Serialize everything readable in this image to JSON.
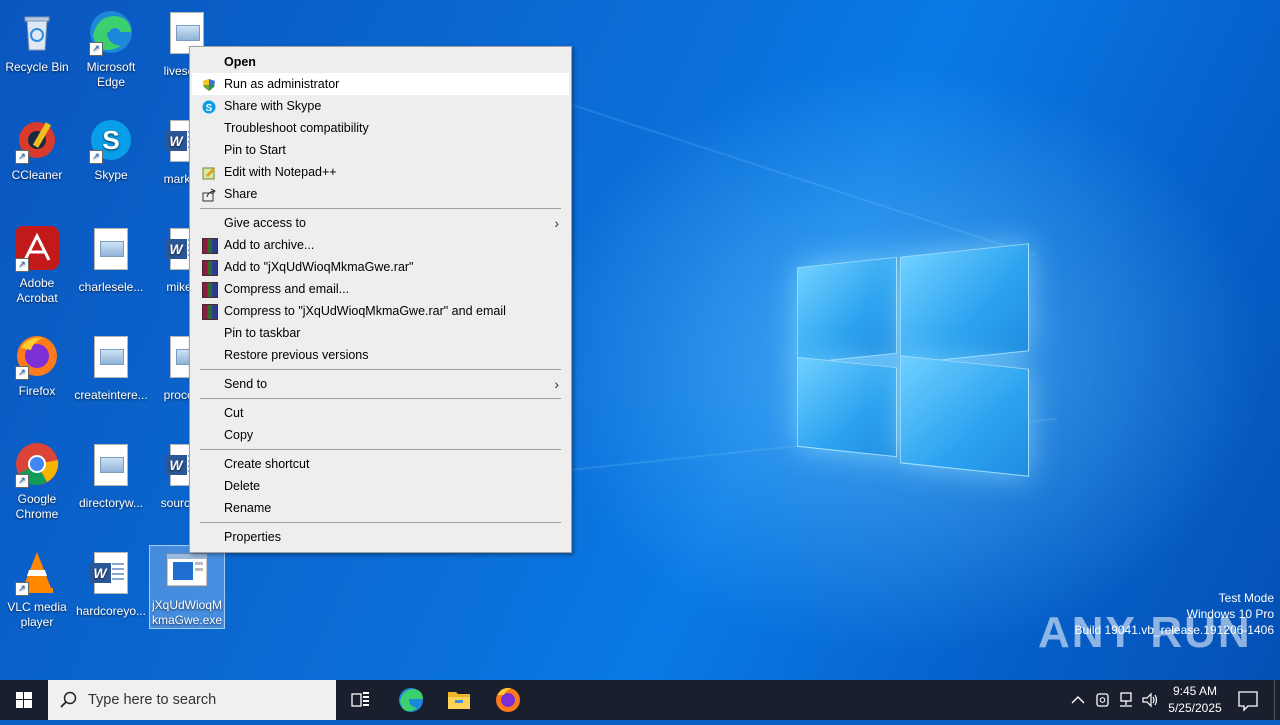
{
  "desktop_icons": [
    {
      "label": "Recycle Bin"
    },
    {
      "label": "Microsoft Edge"
    },
    {
      "label": "livescu..."
    },
    {
      "label": "CCleaner"
    },
    {
      "label": "Skype"
    },
    {
      "label": "market..."
    },
    {
      "label": "Adobe Acrobat"
    },
    {
      "label": "charlesele..."
    },
    {
      "label": "mikes..."
    },
    {
      "label": "Firefox"
    },
    {
      "label": "createintere..."
    },
    {
      "label": "proced..."
    },
    {
      "label": "Google Chrome"
    },
    {
      "label": "directoryw..."
    },
    {
      "label": "sourcep..."
    },
    {
      "label": "VLC media player"
    },
    {
      "label": "hardcoreyo..."
    },
    {
      "label": "jXqUdWioqMkmaGwe.exe"
    }
  ],
  "context_menu": {
    "items": [
      {
        "label": "Open"
      },
      {
        "label": "Run as administrator"
      },
      {
        "label": "Share with Skype"
      },
      {
        "label": "Troubleshoot compatibility"
      },
      {
        "label": "Pin to Start"
      },
      {
        "label": "Edit with Notepad++"
      },
      {
        "label": "Share"
      },
      {
        "label": "Give access to"
      },
      {
        "label": "Add to archive..."
      },
      {
        "label": "Add to \"jXqUdWioqMkmaGwe.rar\""
      },
      {
        "label": "Compress and email..."
      },
      {
        "label": "Compress to \"jXqUdWioqMkmaGwe.rar\" and email"
      },
      {
        "label": "Pin to taskbar"
      },
      {
        "label": "Restore previous versions"
      },
      {
        "label": "Send to"
      },
      {
        "label": "Cut"
      },
      {
        "label": "Copy"
      },
      {
        "label": "Create shortcut"
      },
      {
        "label": "Delete"
      },
      {
        "label": "Rename"
      },
      {
        "label": "Properties"
      }
    ]
  },
  "watermark": {
    "brand": "ANY RUN",
    "line1": "Test Mode",
    "line2": "Windows 10 Pro",
    "line3": "Build 19041.vb_release.191206-1406"
  },
  "taskbar": {
    "search_placeholder": "Type here to search",
    "time": "9:45 AM",
    "date": "5/25/2025"
  }
}
